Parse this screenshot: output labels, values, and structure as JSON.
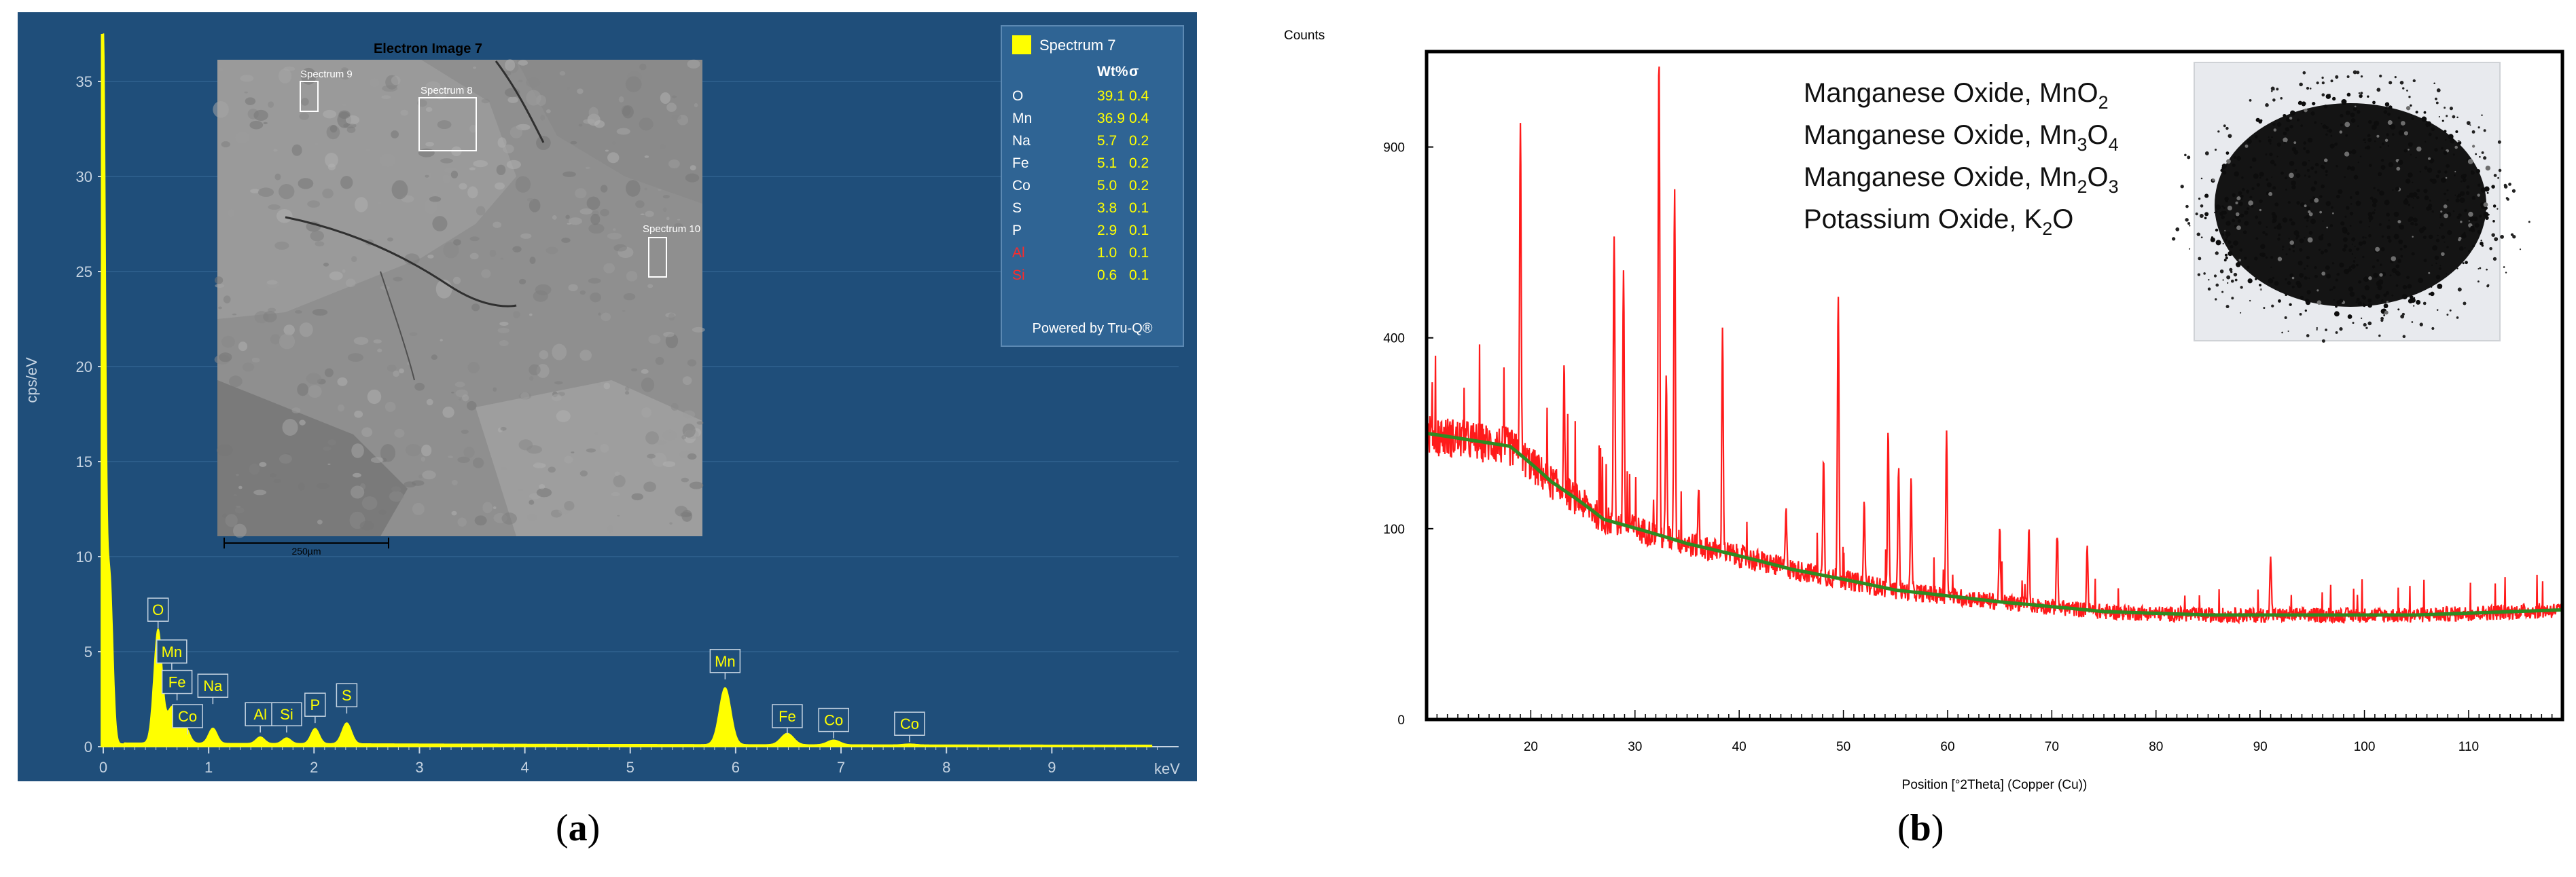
{
  "panel_a": {
    "label": "a",
    "sem_image": {
      "title": "Electron Image 7",
      "scale_label": "250µm",
      "spectra_labels": [
        "Spectrum 9",
        "Spectrum 8",
        "Spectrum 10"
      ]
    },
    "table": {
      "series_name": "Spectrum 7",
      "col_wt": "Wt%",
      "col_sigma": "σ",
      "footer": "Powered by Tru-Q®",
      "rows": [
        {
          "el": "O",
          "wt": "39.1",
          "sd": "0.4",
          "flag": false
        },
        {
          "el": "Mn",
          "wt": "36.9",
          "sd": "0.4",
          "flag": false
        },
        {
          "el": "Na",
          "wt": "5.7",
          "sd": "0.2",
          "flag": false
        },
        {
          "el": "Fe",
          "wt": "5.1",
          "sd": "0.2",
          "flag": false
        },
        {
          "el": "Co",
          "wt": "5.0",
          "sd": "0.2",
          "flag": false
        },
        {
          "el": "S",
          "wt": "3.8",
          "sd": "0.1",
          "flag": false
        },
        {
          "el": "P",
          "wt": "2.9",
          "sd": "0.1",
          "flag": false
        },
        {
          "el": "Al",
          "wt": "1.0",
          "sd": "0.1",
          "flag": true
        },
        {
          "el": "Si",
          "wt": "0.6",
          "sd": "0.1",
          "flag": true
        }
      ]
    },
    "colors": {
      "bg": "#1f4e7a",
      "spectrum": "#ffff00",
      "flag": "#ff2a2a",
      "axis": "#c6d4e2"
    }
  },
  "panel_b": {
    "label": "b",
    "legend_lines": [
      {
        "text": "Manganese Oxide, MnO",
        "sub": "2",
        "tail": ""
      },
      {
        "text": "Manganese Oxide, Mn",
        "sub": "3",
        "tail": "O",
        "sub2": "4"
      },
      {
        "text": "Manganese Oxide, Mn",
        "sub": "2",
        "tail": "O",
        "sub2": "3"
      },
      {
        "text": "Potassium Oxide, K",
        "sub": "2",
        "tail": "O"
      }
    ],
    "colors": {
      "pattern": "#ff1a1a",
      "background_fit": "#2e8b22"
    }
  },
  "chart_data": [
    {
      "type": "area",
      "xlabel": "keV",
      "ylabel": "cps/eV",
      "xlim": [
        -0.1,
        10.1
      ],
      "ylim": [
        0,
        37.5
      ],
      "xticks": [
        0,
        1,
        2,
        3,
        4,
        5,
        6,
        7,
        8,
        9
      ],
      "yticks": [
        0,
        5,
        10,
        15,
        20,
        25,
        30,
        35
      ],
      "series": [
        {
          "name": "Spectrum 7",
          "peaks": [
            {
              "x": 0.0,
              "y": 37.0,
              "w": 0.02
            },
            {
              "x": 0.06,
              "y": 9.0,
              "w": 0.03
            },
            {
              "x": 0.52,
              "y": 6.0,
              "w": 0.04
            },
            {
              "x": 0.64,
              "y": 1.5,
              "w": 0.04
            },
            {
              "x": 0.7,
              "y": 1.0,
              "w": 0.04
            },
            {
              "x": 0.78,
              "y": 0.8,
              "w": 0.04
            },
            {
              "x": 1.04,
              "y": 0.8,
              "w": 0.04
            },
            {
              "x": 1.49,
              "y": 0.35,
              "w": 0.04
            },
            {
              "x": 1.74,
              "y": 0.3,
              "w": 0.04
            },
            {
              "x": 2.01,
              "y": 0.8,
              "w": 0.04
            },
            {
              "x": 2.31,
              "y": 1.1,
              "w": 0.045
            },
            {
              "x": 5.9,
              "y": 3.0,
              "w": 0.055
            },
            {
              "x": 6.49,
              "y": 0.6,
              "w": 0.06
            },
            {
              "x": 6.93,
              "y": 0.25,
              "w": 0.06
            },
            {
              "x": 7.65,
              "y": 0.05,
              "w": 0.06
            }
          ],
          "continuum": 0.15
        }
      ],
      "peak_labels": [
        {
          "text": "O",
          "x": 0.52,
          "y": 6.6
        },
        {
          "text": "Mn",
          "x": 0.65,
          "y": 4.4
        },
        {
          "text": "Fe",
          "x": 0.7,
          "y": 2.8
        },
        {
          "text": "Co",
          "x": 0.8,
          "y": 1.0
        },
        {
          "text": "Na",
          "x": 1.04,
          "y": 2.6
        },
        {
          "text": "Al",
          "x": 1.49,
          "y": 1.1
        },
        {
          "text": "Si",
          "x": 1.74,
          "y": 1.1
        },
        {
          "text": "P",
          "x": 2.01,
          "y": 1.6
        },
        {
          "text": "S",
          "x": 2.31,
          "y": 2.1
        },
        {
          "text": "Mn",
          "x": 5.9,
          "y": 3.9
        },
        {
          "text": "Fe",
          "x": 6.49,
          "y": 1.0
        },
        {
          "text": "Co",
          "x": 6.93,
          "y": 0.8
        },
        {
          "text": "Co",
          "x": 7.65,
          "y": 0.6
        }
      ]
    },
    {
      "type": "line",
      "title": "Counts",
      "xlabel": "Position [°2Theta] (Copper (Cu))",
      "xlim": [
        10,
        119
      ],
      "y_scale": "sqrt",
      "ylim": [
        0,
        1225
      ],
      "xticks": [
        20,
        30,
        40,
        50,
        60,
        70,
        80,
        90,
        100,
        110
      ],
      "yticks": [
        0,
        100,
        400,
        900
      ],
      "series": [
        {
          "name": "pattern",
          "background": [
            [
              10,
              225
            ],
            [
              18,
              205
            ],
            [
              22,
              155
            ],
            [
              27,
              110
            ],
            [
              35,
              85
            ],
            [
              45,
              62
            ],
            [
              55,
              46
            ],
            [
              65,
              38
            ],
            [
              75,
              32
            ],
            [
              85,
              30
            ],
            [
              95,
              30
            ],
            [
              105,
              30
            ],
            [
              119,
              33
            ]
          ],
          "noise": 0.09,
          "peaks": [
            {
              "x": 19.0,
              "y": 1000
            },
            {
              "x": 23.2,
              "y": 330
            },
            {
              "x": 28.0,
              "y": 645
            },
            {
              "x": 28.9,
              "y": 540
            },
            {
              "x": 32.3,
              "y": 1220
            },
            {
              "x": 33.0,
              "y": 320
            },
            {
              "x": 33.8,
              "y": 780
            },
            {
              "x": 36.1,
              "y": 150
            },
            {
              "x": 38.4,
              "y": 420
            },
            {
              "x": 44.5,
              "y": 130
            },
            {
              "x": 48.1,
              "y": 190
            },
            {
              "x": 49.5,
              "y": 490
            },
            {
              "x": 52.0,
              "y": 130
            },
            {
              "x": 54.3,
              "y": 230
            },
            {
              "x": 55.3,
              "y": 180
            },
            {
              "x": 56.5,
              "y": 160
            },
            {
              "x": 59.9,
              "y": 230
            },
            {
              "x": 65.0,
              "y": 105
            },
            {
              "x": 67.8,
              "y": 100
            },
            {
              "x": 70.5,
              "y": 95
            },
            {
              "x": 73.4,
              "y": 85
            },
            {
              "x": 91.0,
              "y": 75
            }
          ]
        },
        {
          "name": "background-fit"
        }
      ]
    }
  ]
}
